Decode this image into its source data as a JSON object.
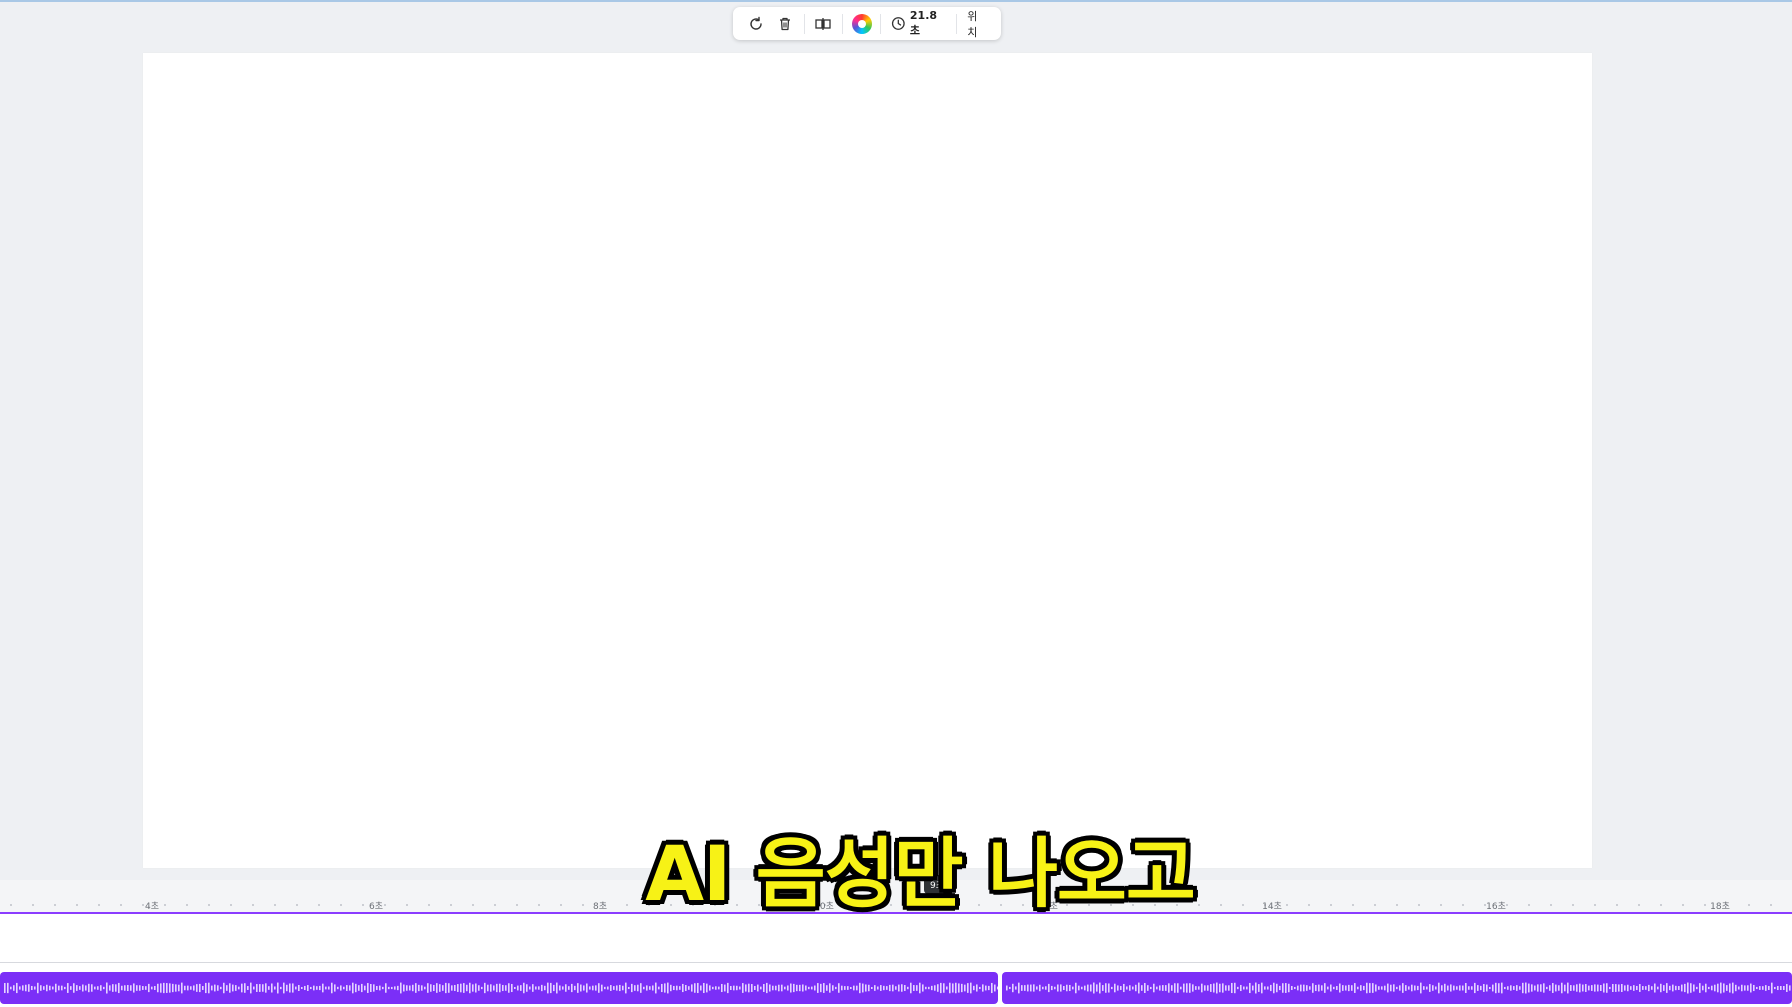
{
  "toolbar": {
    "icons": [
      "refresh-icon",
      "trash-icon",
      "split-icon",
      "color-wheel-icon",
      "clock-icon"
    ],
    "duration_label": "21.8초",
    "position_label": "위치",
    "accent": "#8b3dff"
  },
  "timeline": {
    "ticks": [
      "4초",
      "6초",
      "8초",
      "10초",
      "12초",
      "14초",
      "16초",
      "18초"
    ],
    "tooltip": "9초",
    "audio_color": "#7b2ff7"
  },
  "subtitle": {
    "text": "AI 음성만 나오고"
  }
}
